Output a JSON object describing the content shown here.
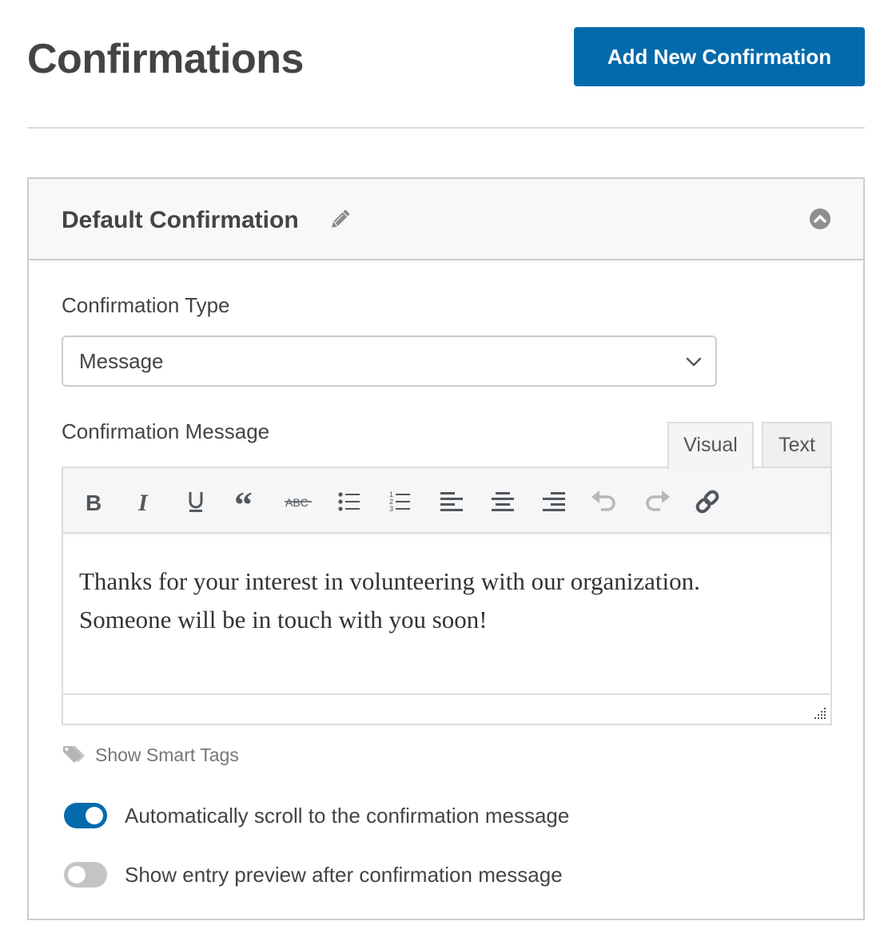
{
  "page": {
    "title": "Confirmations",
    "add_button_label": "Add New Confirmation",
    "accent_color": "#036aab"
  },
  "panel": {
    "title": "Default Confirmation",
    "edit_icon": "pencil-icon",
    "collapse_icon": "chevron-up-circle-icon"
  },
  "confirmation_type": {
    "label": "Confirmation Type",
    "selected": "Message"
  },
  "confirmation_message": {
    "label": "Confirmation Message",
    "tabs": [
      {
        "label": "Visual",
        "active": true
      },
      {
        "label": "Text",
        "active": false
      }
    ],
    "toolbar": [
      {
        "name": "bold",
        "icon": "bold-icon"
      },
      {
        "name": "italic",
        "icon": "italic-icon"
      },
      {
        "name": "underline",
        "icon": "underline-icon"
      },
      {
        "name": "blockquote",
        "icon": "quote-icon"
      },
      {
        "name": "strikethrough",
        "icon": "strikethrough-icon"
      },
      {
        "name": "bulleted-list",
        "icon": "bullet-list-icon"
      },
      {
        "name": "numbered-list",
        "icon": "numbered-list-icon"
      },
      {
        "name": "align-left",
        "icon": "align-left-icon"
      },
      {
        "name": "align-center",
        "icon": "align-center-icon"
      },
      {
        "name": "align-right",
        "icon": "align-right-icon"
      },
      {
        "name": "undo",
        "icon": "undo-icon",
        "disabled": true
      },
      {
        "name": "redo",
        "icon": "redo-icon",
        "disabled": true
      },
      {
        "name": "link",
        "icon": "link-icon"
      }
    ],
    "body_lines": [
      "Thanks for your interest in volunteering with our organization.",
      "Someone will be in touch with you soon!"
    ]
  },
  "smart_tags": {
    "label": "Show Smart Tags"
  },
  "toggles": [
    {
      "label": "Automatically scroll to the confirmation message",
      "on": true
    },
    {
      "label": "Show entry preview after confirmation message",
      "on": false
    }
  ]
}
